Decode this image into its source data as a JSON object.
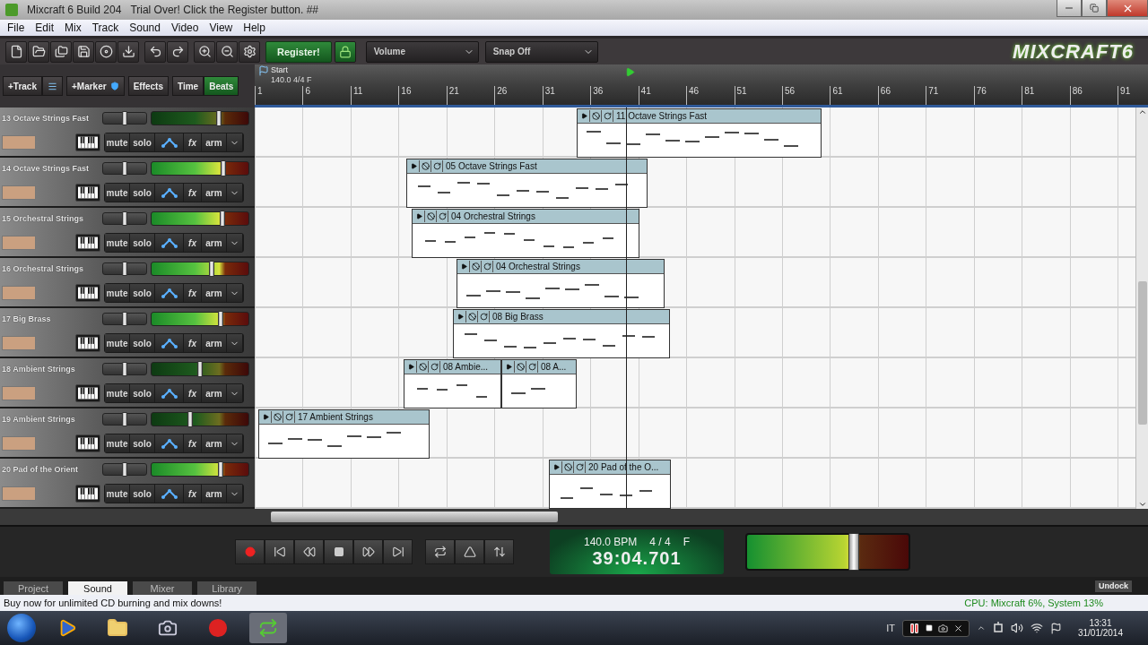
{
  "window": {
    "app": "Mixcraft 6 Build 204",
    "title": "Trial Over!  Click the Register button. ##"
  },
  "menu": [
    "File",
    "Edit",
    "Mix",
    "Track",
    "Sound",
    "Video",
    "View",
    "Help"
  ],
  "toolbar": {
    "register": "Register!",
    "volume_dropdown": "Volume",
    "snap_dropdown": "Snap Off",
    "logo": "MIXCRAFT6"
  },
  "track_header": {
    "add_track": "+Track",
    "add_marker": "+Marker",
    "effects": "Effects",
    "modes": [
      {
        "label": "Time",
        "selected": false
      },
      {
        "label": "Beats",
        "selected": true
      }
    ]
  },
  "ruler": {
    "marker": "Start",
    "marker_info": "140.0 4/4 F",
    "ticks": [
      "1",
      "6",
      "11",
      "16",
      "21",
      "26",
      "31",
      "36",
      "41",
      "46",
      "51",
      "56",
      "61",
      "66",
      "71",
      "76",
      "81",
      "86",
      "91"
    ]
  },
  "tracks": [
    {
      "name": "13 Octave Strings Fast",
      "pan": {
        "level": 0.5
      },
      "volume": {
        "level": 0.69
      },
      "active": false,
      "buttons": [
        "mute",
        "solo",
        "fx",
        "arm"
      ],
      "clips": [
        {
          "name": "11 Octave Strings Fast"
        }
      ]
    },
    {
      "name": "14 Octave Strings Fast",
      "pan": {
        "level": 0.5
      },
      "volume": {
        "level": 0.74
      },
      "active": true,
      "buttons": [
        "mute",
        "solo",
        "fx",
        "arm"
      ],
      "clips": [
        {
          "name": "05 Octave Strings Fast"
        }
      ]
    },
    {
      "name": "15 Orchestral Strings",
      "pan": {
        "level": 0.5
      },
      "volume": {
        "level": 0.73
      },
      "active": true,
      "buttons": [
        "mute",
        "solo",
        "fx",
        "arm"
      ],
      "clips": [
        {
          "name": "04 Orchestral Strings"
        }
      ]
    },
    {
      "name": "16 Orchestral Strings",
      "pan": {
        "level": 0.5
      },
      "volume": {
        "level": 0.62
      },
      "active": true,
      "buttons": [
        "mute",
        "solo",
        "fx",
        "arm"
      ],
      "clips": [
        {
          "name": "04 Orchestral Strings"
        }
      ]
    },
    {
      "name": "17 Big Brass",
      "pan": {
        "level": 0.5
      },
      "volume": {
        "level": 0.71
      },
      "active": true,
      "buttons": [
        "mute",
        "solo",
        "fx",
        "arm"
      ],
      "clips": [
        {
          "name": "08 Big Brass"
        }
      ]
    },
    {
      "name": "18 Ambient Strings",
      "pan": {
        "level": 0.5
      },
      "volume": {
        "level": 0.5
      },
      "active": false,
      "buttons": [
        "mute",
        "solo",
        "fx",
        "arm"
      ],
      "clips": [
        {
          "name": "08 Ambie..."
        },
        {
          "name": "08 A..."
        }
      ]
    },
    {
      "name": "19 Ambient Strings",
      "pan": {
        "level": 0.5
      },
      "volume": {
        "level": 0.4
      },
      "active": false,
      "buttons": [
        "mute",
        "solo",
        "fx",
        "arm"
      ],
      "clips": [
        {
          "name": "17 Ambient Strings"
        }
      ]
    },
    {
      "name": "20 Pad of the Orient",
      "pan": {
        "level": 0.5
      },
      "volume": {
        "level": 0.71
      },
      "active": true,
      "buttons": [
        "mute",
        "solo",
        "fx",
        "arm"
      ],
      "clips": [
        {
          "name": "20 Pad of the O..."
        }
      ]
    }
  ],
  "transport": {
    "tempo": "140.0 BPM",
    "signature": "4 / 4",
    "key": "F",
    "time": "39:04.701",
    "master_meter": {
      "level": 0.66
    }
  },
  "tabs": [
    {
      "label": "Project",
      "selected": false
    },
    {
      "label": "Sound",
      "selected": true
    },
    {
      "label": "Mixer",
      "selected": false
    },
    {
      "label": "Library",
      "selected": false
    }
  ],
  "undock": "Undock",
  "status_bar": {
    "message": "Buy now for unlimited CD burning and mix downs!",
    "cpu": "CPU: Mixcraft 6%, System 13%"
  },
  "taskbar": {
    "language": "IT",
    "time": "13:31",
    "date": "31/01/2014"
  }
}
